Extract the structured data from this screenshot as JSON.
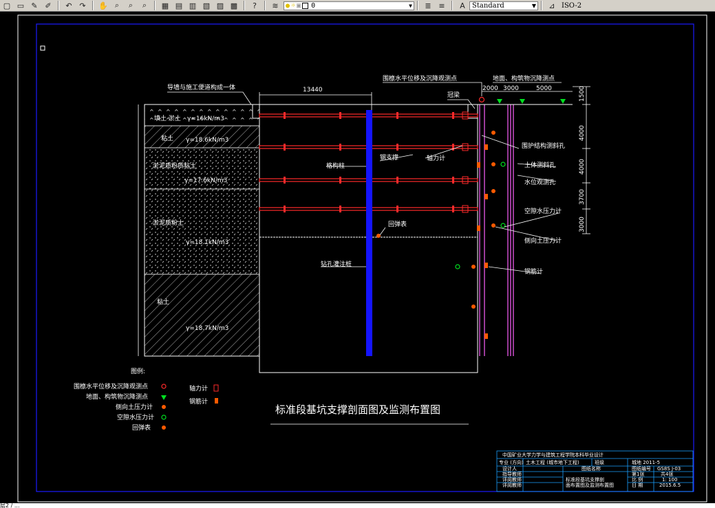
{
  "toolbar": {
    "layer_value": "0",
    "text_style": "Standard",
    "dim_style": "ISO-2"
  },
  "drawing": {
    "title": "标准段基坑支撑剖面图及监测布置图",
    "note_guidewall": "导墙与施工便道构成一体",
    "dim_13440": "13440",
    "label_ring_beam_points": "围檩水平位移及沉降观测点",
    "label_ground_settlement": "地面、构筑物沉降测点",
    "dim_2000": "2000",
    "dim_3000": "3000",
    "dim_5000": "5000",
    "label_ring_beam": "冠梁",
    "label_lattice_column": "格构柱",
    "label_steel_strut": "钢支撑",
    "label_axial_gauge": "轴力计",
    "label_rebound_gauge": "回弹表",
    "label_bored_pile": "钻孔灌注桩",
    "label_wall_incline": "围护结构测斜孔",
    "label_soil_incline": "土体测斜孔",
    "label_water_level": "水位观测孔",
    "label_pore_pressure": "空隙水压力计",
    "label_earth_pressure": "侧向土压力计",
    "label_rebar_gauge": "钢筋计",
    "vdims": [
      "1500",
      "4000",
      "4000",
      "3700",
      "3000"
    ],
    "soils": [
      {
        "name": "填土  淤土",
        "gamma": "γ=16kN/m3"
      },
      {
        "name": "粘土",
        "gamma": "γ=18.6kN/m3"
      },
      {
        "name": "淤泥质粉质粘土",
        "gamma": "γ=17.6kN/m3"
      },
      {
        "name": "淤泥质粉土",
        "gamma": "γ=18.1kN/m3"
      },
      {
        "name": "粘土",
        "gamma": "γ=18.7kN/m3"
      }
    ],
    "legend": {
      "title": "图例:",
      "items": [
        "围檩水平位移及沉降观测点",
        "地面、构筑物沉降测点",
        "侧向土压力计",
        "空隙水压力计",
        "回弹表"
      ],
      "axial": "轴力计",
      "rebar": "钢筋计"
    },
    "title_block": {
      "header": "中国矿业大学力学与建筑工程学院本科毕业设计",
      "major_label": "专业 (方向)",
      "major_value": "土木工程 (城市地下工程)",
      "class_label": "班级",
      "class_value": "城地 2011-5",
      "drawing_name_label": "图纸名称",
      "drawing_no_label": "图纸编号",
      "drawing_no_value": "GS8S J-03",
      "page_label": "第1张",
      "total_label": "共4张",
      "designer_label": "设计人",
      "advisor_label": "指导教师",
      "reviewer1_label": "评阅教师",
      "reviewer2_label": "评阅教师",
      "drawing_name_value_1": "标准段基坑支撑剖",
      "drawing_name_value_2": "面布置图及监测布置图",
      "scale_label": "比 例",
      "scale_value": "1: 100",
      "date_label": "日 期",
      "date_value": "2015.6.5"
    }
  },
  "status": {
    "cmd": "层2 / ..."
  },
  "colors": {
    "frame": "#1a1aff",
    "outline": "#ffffff",
    "strut": "#ff2a2a",
    "column": "#1414ff",
    "wall": "#ff60ff",
    "gauge": "#ff5a00",
    "green": "#00e020",
    "label": "#ffffff",
    "dim": "#ffffff"
  }
}
